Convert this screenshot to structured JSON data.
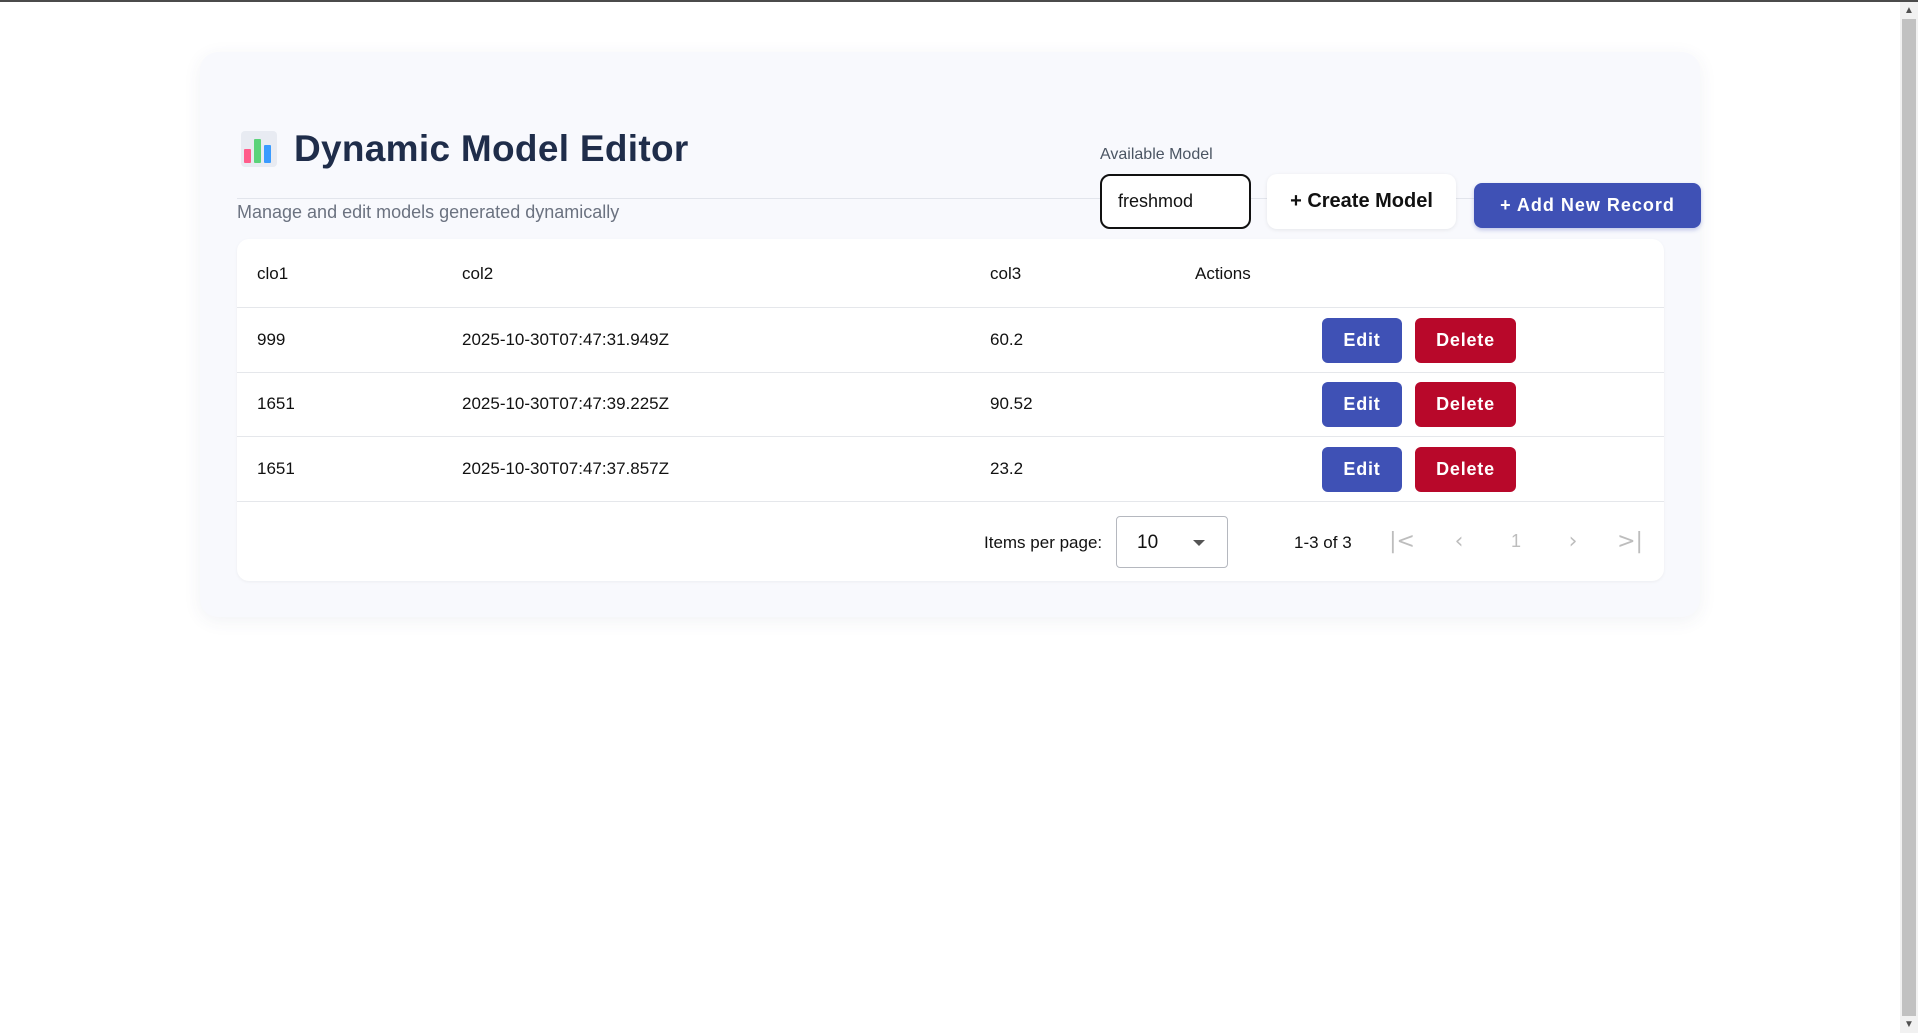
{
  "header": {
    "title": "Dynamic Model Editor",
    "subtitle": "Manage and edit models generated dynamically",
    "icon": "bar-chart-icon"
  },
  "model_selector": {
    "label": "Available Model",
    "value": "freshmod"
  },
  "buttons": {
    "create_model": "+ Create Model",
    "add_record": "+ Add New Record"
  },
  "table": {
    "columns": [
      "clo1",
      "col2",
      "col3",
      "Actions"
    ],
    "rows": [
      {
        "c1": "999",
        "c2": "2025-10-30T07:47:31.949Z",
        "c3": "60.2"
      },
      {
        "c1": "1651",
        "c2": "2025-10-30T07:47:39.225Z",
        "c3": "90.52"
      },
      {
        "c1": "1651",
        "c2": "2025-10-30T07:47:37.857Z",
        "c3": "23.2"
      }
    ],
    "edit_label": "Edit",
    "delete_label": "Delete"
  },
  "paginator": {
    "items_per_page_label": "Items per page:",
    "items_per_page": "10",
    "range_label": "1-3 of 3",
    "current_page": "1",
    "first_icon": "first-page-icon",
    "prev_icon": "chevron-left-icon",
    "next_icon": "chevron-right-icon",
    "last_icon": "last-page-icon"
  },
  "colors": {
    "primary": "#3f51b5",
    "danger": "#b8082a",
    "title": "#1f2d4a"
  }
}
